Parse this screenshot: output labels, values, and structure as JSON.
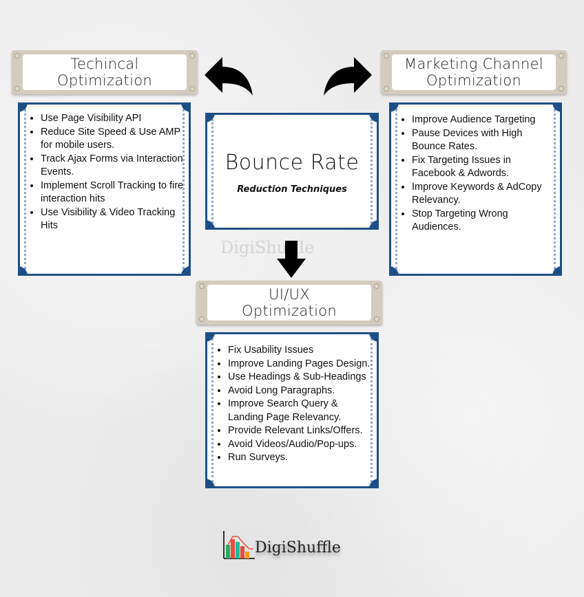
{
  "center": {
    "title": "Bounce Rate",
    "subtitle": "Reduction Techniques"
  },
  "sections": {
    "technical": {
      "title_line1": "Techincal",
      "title_line2": "Optimization",
      "items": [
        "Use Page Visibility API",
        "Reduce Site Speed & Use AMP for mobile users.",
        "Track Ajax Forms via Interaction Events.",
        "Implement Scroll Tracking to fire interaction hits",
        "Use Visibility &  Video Tracking Hits"
      ]
    },
    "marketing": {
      "title_line1": "Marketing Channel",
      "title_line2": "Optimization",
      "items": [
        "Improve Audience Targeting",
        "Pause Devices with High Bounce Rates.",
        "Fix Targeting Issues in Facebook & Adwords.",
        "Improve Keywords & AdCopy Relevancy.",
        "Stop Targeting Wrong Audiences."
      ]
    },
    "uiux": {
      "title_line1": "UI/UX",
      "title_line2": "Optimization",
      "items": [
        "Fix Usability Issues",
        "Improve Landing Pages Design.",
        "Use Headings & Sub-Headings",
        "Avoid Long Paragraphs.",
        "Improve Search Query & Landing Page Relevancy.",
        "Provide Relevant Links/Offers.",
        "Avoid Videos/Audio/Pop-ups.",
        "Run Surveys."
      ]
    }
  },
  "logo": {
    "text": "DigiShuffle",
    "watermark_text": "DigiShuffle",
    "bar_colors": [
      "#27ae60",
      "#e74c3c",
      "#1abc9c",
      "#e74c3c",
      "#f39c12"
    ]
  },
  "colors": {
    "card_border": "#1d4f86",
    "plaque": "#d3cbbd",
    "arrow": "#000000"
  }
}
